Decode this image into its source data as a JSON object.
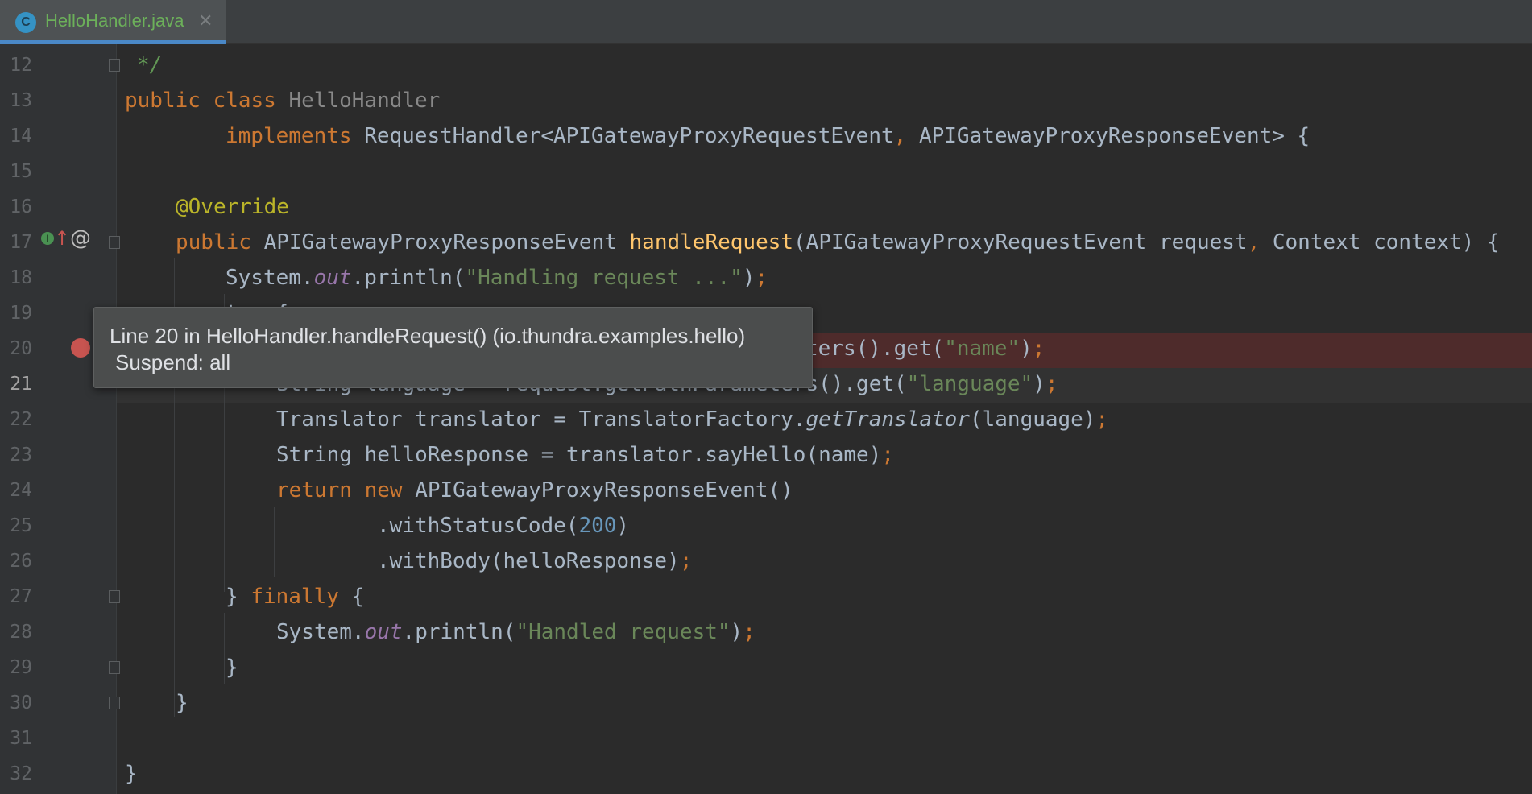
{
  "tab": {
    "icon_letter": "C",
    "filename": "HelloHandler.java",
    "close_glyph": "✕",
    "icon": "class-icon"
  },
  "gutter": {
    "line_numbers": [
      "12",
      "13",
      "14",
      "15",
      "16",
      "17",
      "18",
      "19",
      "20",
      "21",
      "22",
      "23",
      "24",
      "25",
      "26",
      "27",
      "28",
      "29",
      "30",
      "31",
      "32"
    ],
    "current_line": "21",
    "breakpoint_line": "20"
  },
  "code": {
    "l12": "*/",
    "l13_kw": "public class ",
    "l13_name": "HelloHandler",
    "l14_kw": "implements ",
    "l14_rest": "RequestHandler<APIGatewayProxyRequestEvent",
    "l14_comma": ", ",
    "l14_rest2": "APIGatewayProxyResponseEvent> {",
    "l16": "@Override",
    "l17_kw": "public ",
    "l17_type": "APIGatewayProxyResponseEvent ",
    "l17_fn": "handleRequest",
    "l17_args1": "(APIGatewayProxyRequestEvent request",
    "l17_comma": ", ",
    "l17_args2": "Context context) {",
    "l18_a": "System.",
    "l18_fld": "out",
    "l18_b": ".println(",
    "l18_str": "\"Handling request ...\"",
    "l18_c": ")",
    "l18_semi": ";",
    "l19": "try {",
    "l20_a": "ters().get(",
    "l20_str": "\"name\"",
    "l20_b": ")",
    "l20_semi": ";",
    "l21_a": "String language = request.getPathParameters",
    "l21_b": "().get(",
    "l21_str": "\"language\"",
    "l21_c": ")",
    "l21_semi": ";",
    "l22_a": "Translator translator = TranslatorFactory.",
    "l22_it": "getTranslator",
    "l22_b": "(language)",
    "l22_semi": ";",
    "l23_a": "String helloResponse = translator.sayHello(name)",
    "l23_semi": ";",
    "l24_kw": "return new ",
    "l24_rest": "APIGatewayProxyResponseEvent()",
    "l25_a": ".withStatusCode(",
    "l25_num": "200",
    "l25_b": ")",
    "l26_a": ".withBody(helloResponse)",
    "l26_semi": ";",
    "l27_a": "} ",
    "l27_kw": "finally ",
    "l27_b": "{",
    "l28_a": "System.",
    "l28_fld": "out",
    "l28_b": ".println(",
    "l28_str": "\"Handled request\"",
    "l28_c": ")",
    "l28_semi": ";",
    "l29": "}",
    "l30": "}",
    "l32": "}"
  },
  "tooltip": {
    "line1": "Line 20 in HelloHandler.handleRequest() (io.thundra.examples.hello)",
    "line2": "Suspend: all"
  },
  "colors": {
    "keyword": "#cc7832",
    "string": "#6a8759",
    "annotation": "#bbb529",
    "method": "#ffc66d",
    "number": "#6897bb",
    "breakpoint": "#c75450"
  }
}
